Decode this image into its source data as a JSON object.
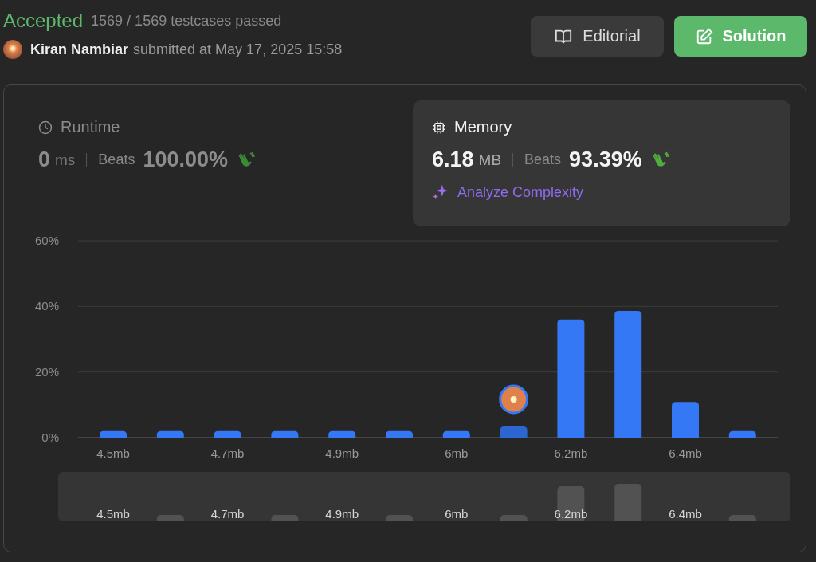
{
  "header": {
    "status": "Accepted",
    "testcases": "1569 / 1569 testcases passed",
    "author": "Kiran Nambiar",
    "submitted": "submitted at May 17, 2025 15:58"
  },
  "buttons": [
    {
      "label": "Editorial",
      "kind": "secondary"
    },
    {
      "label": "Solution",
      "kind": "primary"
    }
  ],
  "metrics": [
    {
      "kind": "runtime",
      "title": "Runtime",
      "value": "0",
      "unit": "ms",
      "beats_label": "Beats",
      "beats": "100.00%",
      "selected": false
    },
    {
      "kind": "memory",
      "title": "Memory",
      "value": "6.18",
      "unit": "MB",
      "beats_label": "Beats",
      "beats": "93.39%",
      "selected": true,
      "link": "Analyze Complexity"
    }
  ],
  "chart": {
    "chart_data": {
      "type": "bar",
      "categories": [
        "4.5mb",
        null,
        "4.7mb",
        null,
        "4.9mb",
        null,
        "6mb",
        null,
        "6.2mb",
        null,
        "6.4mb",
        null
      ],
      "series": [
        {
          "color": "#3478f6",
          "values": [
            2,
            2,
            2,
            2,
            2,
            2,
            2,
            3.4,
            36,
            38.6,
            10.9,
            2
          ]
        }
      ],
      "ylim": [
        0,
        60
      ],
      "yticks": [
        {
          "value": 0,
          "label": "0%"
        },
        {
          "value": 20,
          "label": "20%"
        },
        {
          "value": 40,
          "label": "40%"
        },
        {
          "value": 60,
          "label": "60%"
        }
      ]
    },
    "bars": [
      {
        "selected": false
      },
      {
        "selected": false
      },
      {
        "selected": false
      },
      {
        "selected": false
      },
      {
        "selected": false
      },
      {
        "selected": false
      },
      {
        "selected": false
      },
      {
        "selected": true
      },
      {
        "selected": false
      },
      {
        "selected": false
      },
      {
        "selected": false
      },
      {
        "selected": false
      }
    ],
    "overview_labels": [
      "4.5mb",
      "4.7mb",
      "4.9mb",
      "6mb",
      "6.2mb",
      "6.4mb"
    ]
  }
}
